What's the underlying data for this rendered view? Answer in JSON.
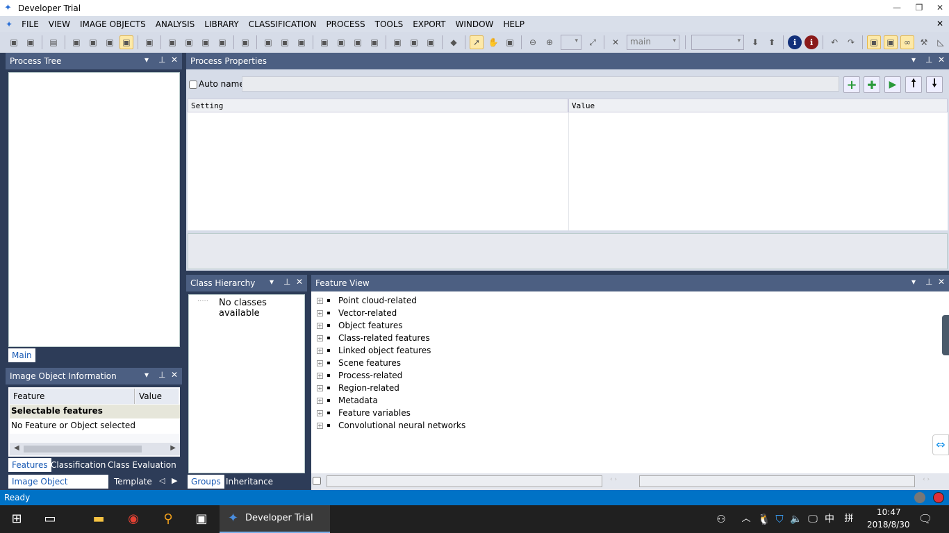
{
  "window": {
    "title": "Developer Trial",
    "minimize": "—",
    "restore": "❐",
    "close": "✕"
  },
  "menu": [
    "FILE",
    "VIEW",
    "IMAGE OBJECTS",
    "ANALYSIS",
    "LIBRARY",
    "CLASSIFICATION",
    "PROCESS",
    "TOOLS",
    "EXPORT",
    "WINDOW",
    "HELP"
  ],
  "menu_close": "✕",
  "toolbar": {
    "icons": [
      "create-project-icon",
      "open-project-icon",
      "|",
      "save-icon",
      "|",
      "workflow-1-icon",
      "workflow-2-icon",
      "workflow-3-icon",
      "workflow-4-icon",
      "|",
      "view-settings-icon",
      "|",
      "layer-view-1-icon",
      "layer-view-2-icon",
      "layer-view-3-icon",
      "layer-view-4-icon",
      "|",
      "swap-icon",
      "|",
      "outline-icon",
      "text-icon",
      "outline-2-icon",
      "|",
      "single-view-icon",
      "split-view-icon",
      "split-minus-icon",
      "split-plus-icon",
      "|",
      "link-views-icon",
      "cursor-light-icon",
      "cursor-faded-icon",
      "|",
      "polygon-icon",
      "|",
      "pointer-icon",
      "pan-hand-icon",
      "user-zoom-icon",
      "|",
      "zoom-out-icon",
      "zoom-in-icon"
    ],
    "active": [
      "workflow-4-icon",
      "pointer-icon"
    ],
    "zoom_combo": "",
    "map_combo": "main",
    "level_combo": "",
    "right_icons": [
      "zoom-fit-icon",
      "delete-level-icon",
      "arrow-down-icon",
      "arrow-up-icon",
      "info-blue-icon",
      "info-red-icon",
      "undo-icon",
      "redo-icon",
      "process-tree-icon",
      "rule-set-icon",
      "glasses-icon",
      "tools-icon",
      "triangle-ruler-icon"
    ]
  },
  "process_tree": {
    "title": "Process Tree",
    "tab": "Main"
  },
  "image_object_info": {
    "title": "Image Object Information",
    "col_feature": "Feature",
    "col_value": "Value",
    "group": "Selectable features",
    "message": "No Feature or Object selected",
    "tabs": [
      "Features",
      "Classification",
      "Class Evaluation"
    ],
    "bottom_tabs": [
      "Image Object Information",
      "Template Ed"
    ]
  },
  "process_properties": {
    "title": "Process Properties",
    "auto_name": "Auto name",
    "name_value": "",
    "col_setting": "Setting",
    "col_value": "Value"
  },
  "class_hierarchy": {
    "title": "Class Hierarchy",
    "empty": "No classes available",
    "tabs": [
      "Groups",
      "Inheritance"
    ]
  },
  "feature_view": {
    "title": "Feature View",
    "items": [
      "Point cloud-related",
      "Vector-related",
      "Object features",
      "Class-related features",
      "Linked object features",
      "Scene features",
      "Process-related",
      "Region-related",
      "Metadata",
      "Feature variables",
      "Convolutional neural networks"
    ]
  },
  "status": {
    "text": "Ready"
  },
  "taskbar": {
    "app": "Developer Trial",
    "time": "10:47",
    "date": "2018/8/30",
    "ime1": "中",
    "ime2": "拼"
  },
  "colors": {
    "panel_header": "#4c5f82",
    "status_bar": "#0072c6",
    "taskbar": "#202020"
  }
}
